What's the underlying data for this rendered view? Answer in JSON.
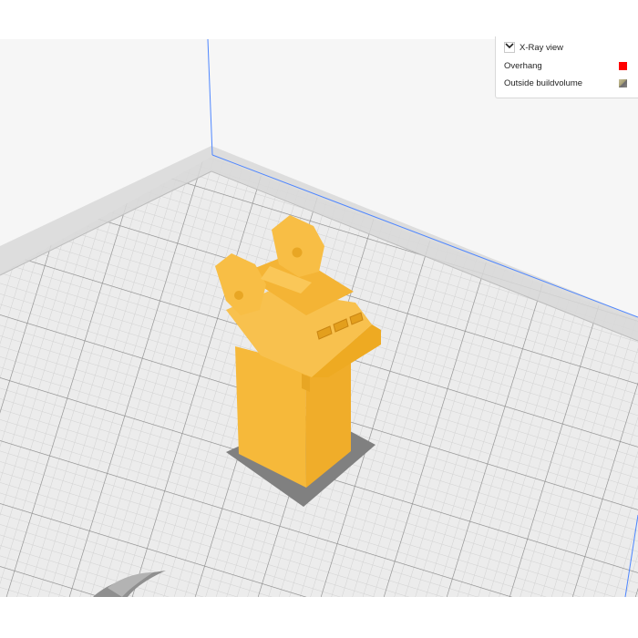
{
  "legend": {
    "xray_label": "X-Ray view",
    "xray_checked": false,
    "overhang_label": "Overhang",
    "outside_label": "Outside buildvolume"
  },
  "colors": {
    "model": "#f6b93a",
    "overhang": "#ff0000",
    "grid_line": "#cfcfcf",
    "grid_major": "#6d6d6d",
    "axis_line": "#4e86ff",
    "background": "#f6f6f6"
  },
  "icons": {
    "expand": "chevron-down-icon",
    "logo": "cura-logo-watermark"
  }
}
